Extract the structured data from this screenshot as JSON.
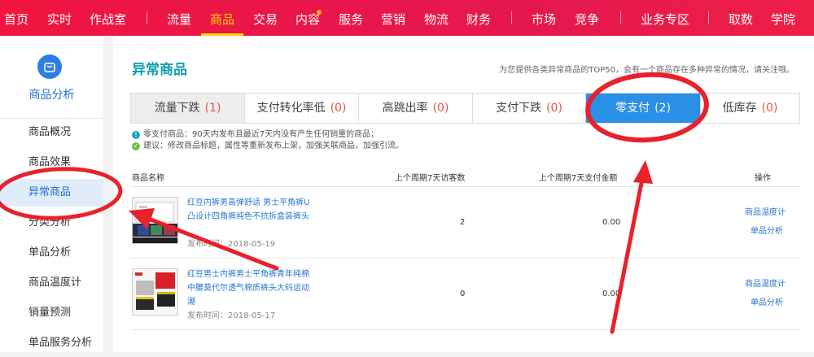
{
  "topnav": {
    "items": [
      "首页",
      "实时",
      "作战室",
      "流量",
      "商品",
      "交易",
      "内容",
      "服务",
      "营销",
      "物流",
      "财务",
      "市场",
      "竞争",
      "业务专区",
      "取数",
      "学院"
    ],
    "active": "商品"
  },
  "sidebar": {
    "title": "商品分析",
    "items": [
      "商品概况",
      "商品效果",
      "异常商品",
      "分类分析",
      "单品分析",
      "商品温度计",
      "销量预测",
      "单品服务分析"
    ],
    "active": "异常商品"
  },
  "main": {
    "title": "异常商品",
    "note": "为您提供各类异常商品的TOP50，会有一个商品存在多种异常的情况，请关注哦。",
    "tabs": [
      {
        "label": "流量下跌",
        "count": "(1)"
      },
      {
        "label": "支付转化率低",
        "count": "(0)"
      },
      {
        "label": "高跳出率",
        "count": "(0)"
      },
      {
        "label": "支付下跌",
        "count": "(0)"
      },
      {
        "label": "零支付",
        "count": "(2)"
      },
      {
        "label": "低库存",
        "count": "(0)"
      }
    ],
    "active_tab": "零支付",
    "tips": {
      "info": "零支付商品：90天内发布且最近7天内没有产生任何销量的商品；",
      "advice": "建议：修改商品标题，属性等重新发布上架，加强关联商品，加强引流。"
    },
    "table": {
      "headers": {
        "name": "商品名称",
        "visitors": "上个周期7天访客数",
        "amount": "上个周期7天支付金额",
        "actions": "操作"
      },
      "rows": [
        {
          "name": "红豆内裤男高弹舒适 男士平角裤U凸设计四角裤纯色不抗拆盒装裤头",
          "date": "发布时间：2018-05-19",
          "visitors": "2",
          "amount": "0.00",
          "op1": "商品温度计",
          "op2": "单品分析"
        },
        {
          "name": "红豆男士内裤男士平角裤青年纯棉中腰莫代尔透气棉质裤头大码运动潮",
          "date": "发布时间：2018-05-17",
          "visitors": "0",
          "amount": "0.00",
          "op1": "商品温度计",
          "op2": "单品分析"
        }
      ]
    }
  },
  "colors": {
    "nav_red": "#ed1846",
    "active_yellow": "#ffd500",
    "tab_blue": "#2a8fe6",
    "annotation_red": "#e8212b",
    "title_teal": "#0e9fb0"
  }
}
